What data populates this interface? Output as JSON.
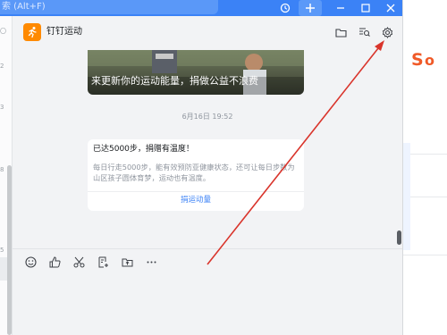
{
  "titlebar": {
    "search_placeholder": "索 (Alt+F)"
  },
  "chat": {
    "title": "钉钉运动",
    "promo_caption": "来更新你的运动能量，捐做公益不浪费",
    "timestamp": "6月16日 19:52",
    "card": {
      "title": "已达5000步，捐赠有温度！",
      "body": "每日行走5000步，能有效预防亚健康状态，还可让每日步数为山区孩子圆体育梦，运动也有温度。",
      "link": "捐运动量"
    }
  },
  "sidebar_marks": [
    "〇",
    "2",
    "3",
    "8",
    "5"
  ],
  "icons": {
    "header": [
      "folder-icon",
      "search-history-icon",
      "gear-icon"
    ],
    "toolbar": [
      "emoji-icon",
      "like-icon",
      "scissors-icon",
      "doc-add-icon",
      "folder-upload-icon",
      "more-icon"
    ]
  },
  "colors": {
    "accent": "#3b82f6",
    "brand_orange": "#ff8a00",
    "annotation": "#d9342b"
  }
}
